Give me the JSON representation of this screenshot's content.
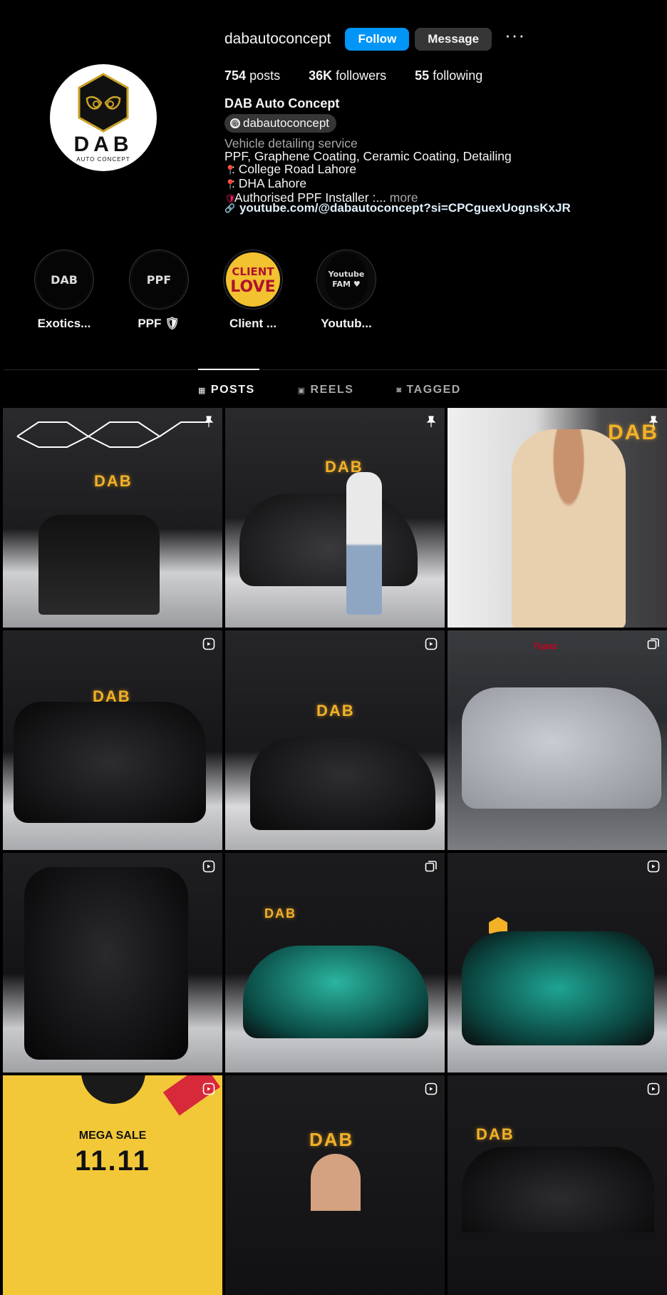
{
  "profile": {
    "username": "dabautoconcept",
    "follow_label": "Follow",
    "message_label": "Message",
    "more_label": "···",
    "posts_count": "754",
    "posts_label": "posts",
    "followers_count": "36K",
    "followers_label": "followers",
    "following_count": "55",
    "following_label": "following",
    "full_name": "DAB Auto Concept",
    "threads_handle": "dabautoconcept",
    "category": "Vehicle detailing service",
    "bio_line1": "PPF, Graphene Coating, Ceramic Coating, Detailing",
    "bio_line2": ": College Road Lahore",
    "bio_line3": ": DHA Lahore",
    "bio_line4": "Authorised PPF Installer :...",
    "more_text": "more",
    "link_text": "youtube.com/@dabautoconcept?si=CPCguexUognsKxJR",
    "avatar_brand": "DAB",
    "avatar_sub": "AUTO CONCEPT"
  },
  "highlights": [
    {
      "label": "Exotics...",
      "cover": "DAB"
    },
    {
      "label": "PPF 🛡",
      "cover": "PPF"
    },
    {
      "label": "Client ...",
      "cover_top": "CLIENT",
      "cover_bottom": "LOVE"
    },
    {
      "label": "Youtub...",
      "cover": "Youtube FAM ♥"
    }
  ],
  "tabs": [
    {
      "label": "POSTS",
      "icon": "grid-icon",
      "active": true
    },
    {
      "label": "REELS",
      "icon": "reels-icon",
      "active": false
    },
    {
      "label": "TAGGED",
      "icon": "tagged-icon",
      "active": false
    }
  ],
  "posts": [
    {
      "badge": "pin-icon",
      "caption": "DAB"
    },
    {
      "badge": "pin-icon",
      "caption": "DAB"
    },
    {
      "badge": "pin-icon",
      "caption": "DAB"
    },
    {
      "badge": "reel-icon",
      "caption": "DAB"
    },
    {
      "badge": "reel-icon",
      "caption": "DAB"
    },
    {
      "badge": "carousel-icon",
      "caption": "Topaz"
    },
    {
      "badge": "reel-icon",
      "caption": ""
    },
    {
      "badge": "carousel-icon",
      "caption": "DAB"
    },
    {
      "badge": "reel-icon",
      "caption": ""
    },
    {
      "badge": "reel-icon",
      "caption": "MEGA SALE",
      "caption2": "11.11"
    },
    {
      "badge": "reel-icon",
      "caption": "DAB"
    },
    {
      "badge": "reel-icon",
      "caption": "DAB"
    }
  ],
  "colors": {
    "accent": "#0095f6",
    "background": "#000000",
    "secondary_button": "#363636",
    "brand_gold": "#f3b128"
  }
}
